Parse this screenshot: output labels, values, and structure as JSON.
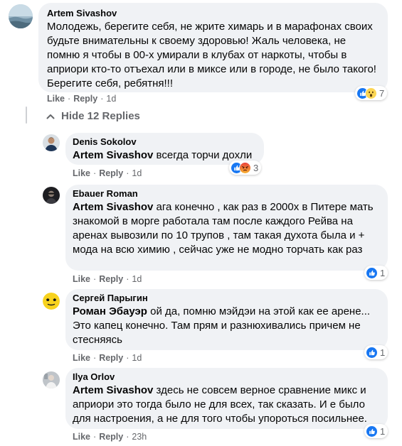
{
  "main_comment": {
    "author": "Artem Sivashov",
    "text": "Молодежь, берегите себя, не жрите химарь и в марафонах своих будьте внимательны к своему здоровью! Жаль человека, не помню я чтобы в 00-х умирали в клубах от наркоты, чтобы в априори кто-то отъехал или в миксе или в городе, не было такого! Берегите себя, ребятня!!!",
    "like_label": "Like",
    "reply_label": "Reply",
    "time": "1d",
    "reaction_count": "7",
    "reaction_icons": [
      "like-icon",
      "wow-icon"
    ]
  },
  "hide_replies_label": "Hide 12 Replies",
  "replies": [
    {
      "author": "Denis Sokolov",
      "mention": "Artem Sivashov",
      "text": " всегда торчи дохли",
      "like_label": "Like",
      "reply_label": "Reply",
      "time": "1d",
      "reaction_count": "3",
      "reaction_icons": [
        "like-icon",
        "angry-icon"
      ]
    },
    {
      "author": "Ebauer Roman",
      "mention": "Artem Sivashov",
      "text": " ага конечно , как раз в 2000х в Питере мать знакомой в морге работала там после каждого Рейва на аренах вывозили по 10 трупов , там такая духота была и + мода на всю химию , сейчас уже не модно торчать как раз",
      "like_label": "Like",
      "reply_label": "Reply",
      "time": "1d",
      "reaction_count": "1",
      "reaction_icons": [
        "like-icon"
      ]
    },
    {
      "author": "Сергей Парыгин",
      "mention": "Роман Эбауэр",
      "text": " ой да, помню мэйдэи на этой как ее арене... Это капец конечно. Там прям и разнюхивались причем не стесняясь",
      "like_label": "Like",
      "reply_label": "Reply",
      "time": "1d",
      "reaction_count": "1",
      "reaction_icons": [
        "like-icon"
      ]
    },
    {
      "author": "Ilya Orlov",
      "mention": "Artem Sivashov",
      "text": " здесь не совсем верное сравнение микс и априори это тогда было не для всех, так сказать. И е было для настроения, а не для того чтобы упороться посильнее.",
      "like_label": "Like",
      "reply_label": "Reply",
      "time": "23h",
      "reaction_count": "1",
      "reaction_icons": [
        "like-icon"
      ]
    }
  ],
  "colors": {
    "bubble_bg": "#f0f2f5",
    "secondary_text": "#65676b",
    "like_blue": "#1877f2",
    "angry_orange": "#f0653b",
    "wow_yellow": "#fcd654"
  }
}
